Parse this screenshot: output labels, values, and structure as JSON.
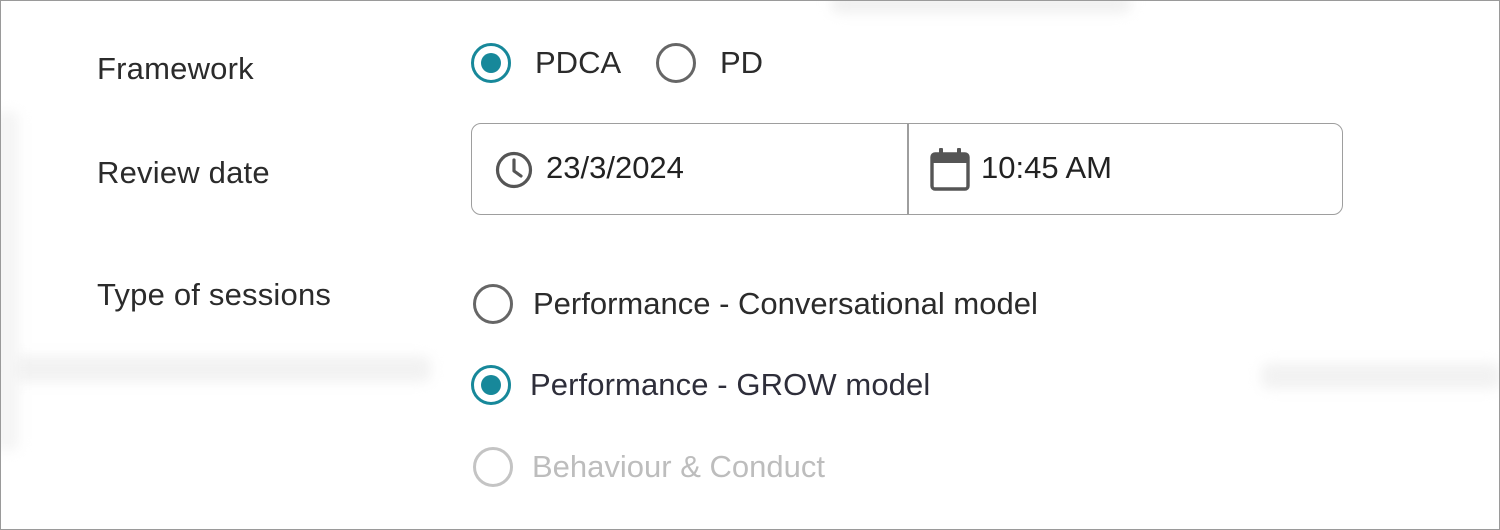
{
  "framework": {
    "label": "Framework",
    "options": [
      {
        "label": "PDCA",
        "selected": true
      },
      {
        "label": "PD",
        "selected": false
      }
    ]
  },
  "review_date": {
    "label": "Review date",
    "date_value": "23/3/2024",
    "date_icon": "clock-icon",
    "time_value": "10:45 AM",
    "time_icon": "calendar-icon"
  },
  "session_types": {
    "label": "Type of sessions",
    "options": [
      {
        "label": "Performance - Conversational model",
        "selected": false,
        "disabled": false
      },
      {
        "label": "Performance - GROW model",
        "selected": true,
        "disabled": false
      },
      {
        "label": "Behaviour & Conduct",
        "selected": false,
        "disabled": true
      }
    ]
  },
  "colors": {
    "accent": "#17889a",
    "border": "#9e9e9e",
    "text": "#2b2b2b",
    "disabled": "#bdbdbd"
  }
}
